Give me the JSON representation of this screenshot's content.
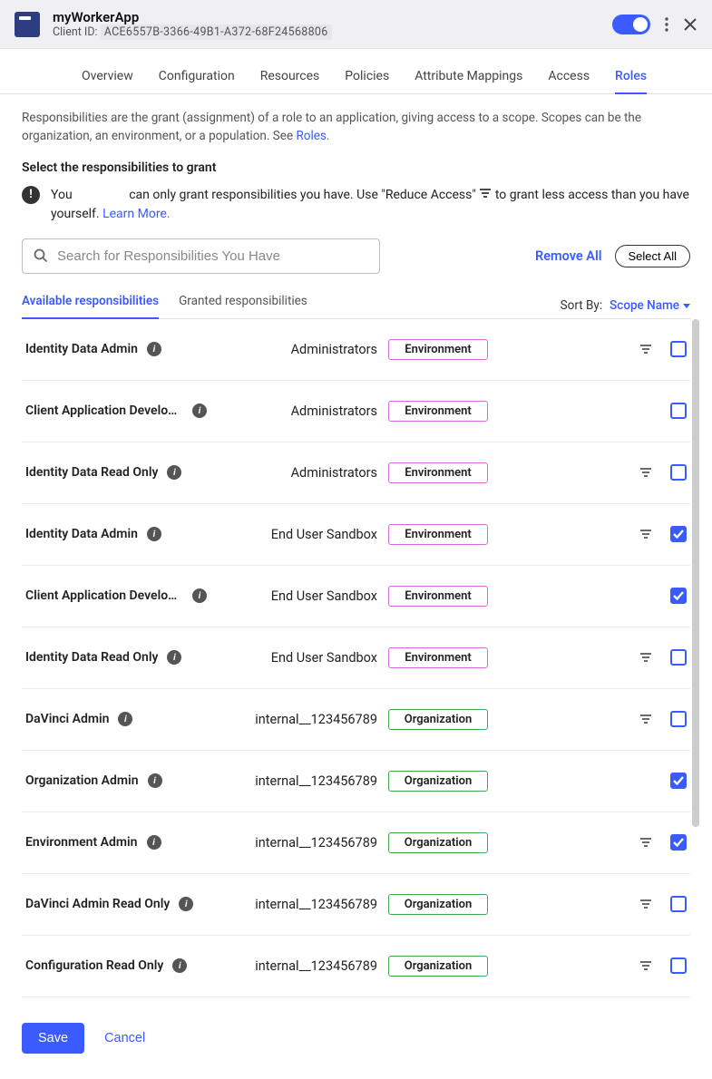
{
  "header": {
    "app_name": "myWorkerApp",
    "client_id_label": "Client ID:",
    "client_id_value": "ACE6557B-3366-49B1-A372-68F24568806"
  },
  "tabs": [
    {
      "label": "Overview",
      "active": false
    },
    {
      "label": "Configuration",
      "active": false
    },
    {
      "label": "Resources",
      "active": false
    },
    {
      "label": "Policies",
      "active": false
    },
    {
      "label": "Attribute Mappings",
      "active": false
    },
    {
      "label": "Access",
      "active": false
    },
    {
      "label": "Roles",
      "active": true
    }
  ],
  "intro": {
    "text_before": "Responsibilities are the grant (assignment) of a role to an application, giving access to a scope. Scopes can be the organization, an environment, or a population. See ",
    "link": "Roles",
    "text_after": "."
  },
  "select_heading": "Select the responsibilities to grant",
  "info_banner": {
    "part1": "You",
    "part2": "can only grant responsibilities you have. Use \"Reduce Access\"",
    "part3": "to grant less access than you have yourself.",
    "learn_more": "Learn More."
  },
  "search_placeholder": "Search for Responsibilities You Have",
  "remove_all": "Remove All",
  "select_all": "Select All",
  "subtabs": {
    "available": "Available responsibilities",
    "granted": "Granted responsibilities"
  },
  "sort": {
    "label": "Sort By:",
    "value": "Scope Name"
  },
  "rows": [
    {
      "role": "Identity Data Admin",
      "scope": "Administrators",
      "badge_type": "env",
      "badge_label": "Environment",
      "has_filter": true,
      "checked": false
    },
    {
      "role": "Client Application Developer",
      "scope": "Administrators",
      "badge_type": "env",
      "badge_label": "Environment",
      "has_filter": false,
      "checked": false
    },
    {
      "role": "Identity Data Read Only",
      "scope": "Administrators",
      "badge_type": "env",
      "badge_label": "Environment",
      "has_filter": true,
      "checked": false
    },
    {
      "role": "Identity Data Admin",
      "scope": "End User Sandbox",
      "badge_type": "env",
      "badge_label": "Environment",
      "has_filter": true,
      "checked": true
    },
    {
      "role": "Client Application Developer",
      "scope": "End User Sandbox",
      "badge_type": "env",
      "badge_label": "Environment",
      "has_filter": false,
      "checked": true
    },
    {
      "role": "Identity Data Read Only",
      "scope": "End User Sandbox",
      "badge_type": "env",
      "badge_label": "Environment",
      "has_filter": true,
      "checked": false
    },
    {
      "role": "DaVinci Admin",
      "scope": "internal_<user>_123456789",
      "badge_type": "org",
      "badge_label": "Organization",
      "has_filter": true,
      "checked": false
    },
    {
      "role": "Organization Admin",
      "scope": "internal_<user>_123456789",
      "badge_type": "org",
      "badge_label": "Organization",
      "has_filter": false,
      "checked": true
    },
    {
      "role": "Environment Admin",
      "scope": "internal_<user>_123456789",
      "badge_type": "org",
      "badge_label": "Organization",
      "has_filter": true,
      "checked": true
    },
    {
      "role": "DaVinci Admin Read Only",
      "scope": "internal_<user>_123456789",
      "badge_type": "org",
      "badge_label": "Organization",
      "has_filter": true,
      "checked": false
    },
    {
      "role": "Configuration Read Only",
      "scope": "internal_<user>_123456789",
      "badge_type": "org",
      "badge_label": "Organization",
      "has_filter": true,
      "checked": false
    }
  ],
  "footer": {
    "save": "Save",
    "cancel": "Cancel"
  }
}
